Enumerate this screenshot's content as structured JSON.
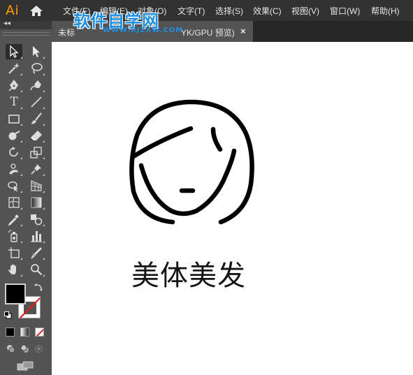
{
  "app": {
    "logo": "Ai",
    "home_icon": "home-icon"
  },
  "menu": [
    {
      "label": "文件(F)"
    },
    {
      "label": "编辑(E)"
    },
    {
      "label": "对象(O)"
    },
    {
      "label": "文字(T)"
    },
    {
      "label": "选择(S)"
    },
    {
      "label": "效果(C)"
    },
    {
      "label": "视图(V)"
    },
    {
      "label": "窗口(W)"
    },
    {
      "label": "帮助(H)"
    }
  ],
  "watermark": {
    "title": "软件自学网",
    "url": "WWW.RJZXW.COM"
  },
  "document_tab": {
    "label_start": "未标",
    "label_end": "YK/GPU 预览)",
    "close": "×"
  },
  "toolbar": {
    "collapse": "◂◂",
    "tools": [
      "selection-tool",
      "direct-selection-tool",
      "magic-wand-tool",
      "lasso-tool",
      "pen-tool",
      "curvature-tool",
      "type-tool",
      "line-segment-tool",
      "rectangle-tool",
      "paintbrush-tool",
      "shaper-tool",
      "eraser-tool",
      "rotate-tool",
      "scale-tool",
      "warp-tool",
      "puppet-warp-tool",
      "shape-builder-tool",
      "perspective-grid-tool",
      "mesh-tool",
      "gradient-tool",
      "eyedropper-tool",
      "blend-tool",
      "symbol-sprayer-tool",
      "column-graph-tool",
      "artboard-tool",
      "slice-tool",
      "hand-tool",
      "zoom-tool"
    ],
    "type_glyph": "T",
    "fill_color": "#000000",
    "stroke_color": "none",
    "colors": {
      "accent": "#ff9a00",
      "panel": "#535353",
      "menubar": "#323232",
      "watermark": "#1f8fe0"
    }
  },
  "canvas": {
    "caption": "美体美发"
  }
}
